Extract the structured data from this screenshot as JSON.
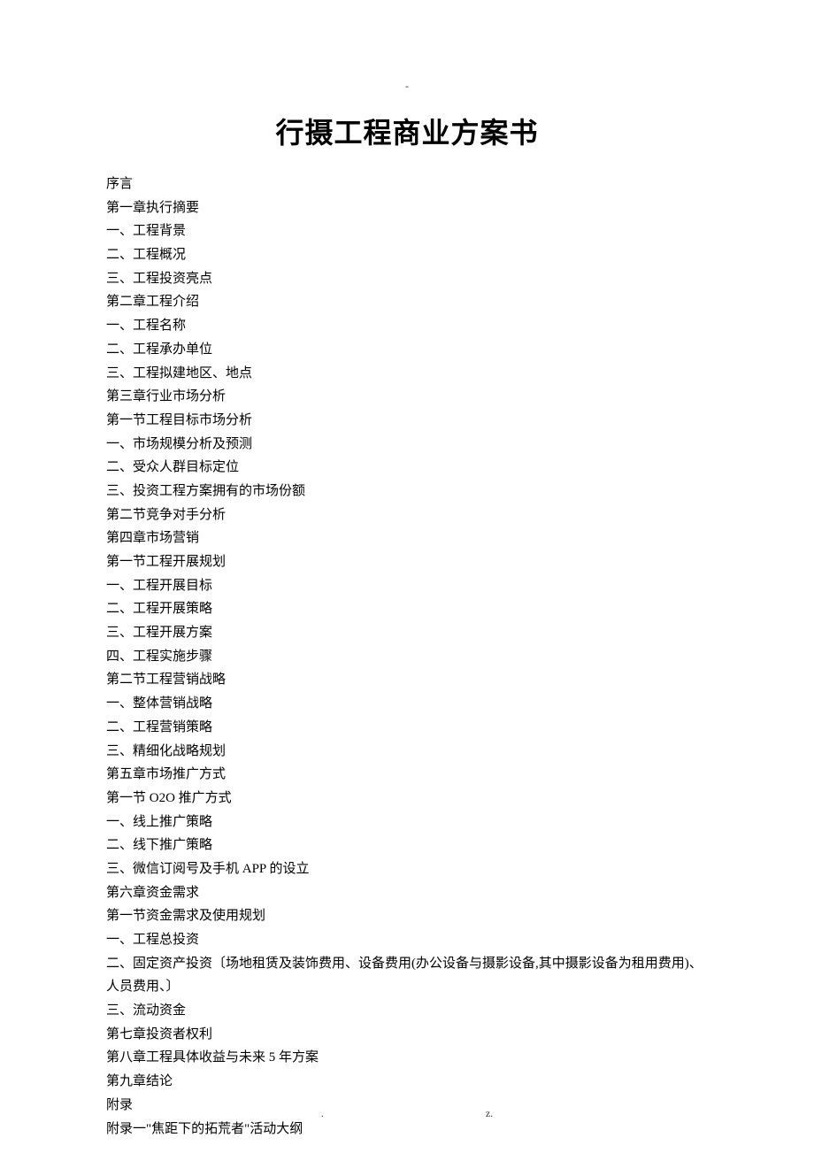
{
  "top_marker": "-",
  "title": "行摄工程商业方案书",
  "toc": [
    "序言",
    "第一章执行摘要",
    "一、工程背景",
    "二、工程概况",
    "三、工程投资亮点",
    "第二章工程介绍",
    "一、工程名称",
    "二、工程承办单位",
    "三、工程拟建地区、地点",
    "第三章行业市场分析",
    "第一节工程目标市场分析",
    "一、市场规模分析及预测",
    "二、受众人群目标定位",
    "三、投资工程方案拥有的市场份额",
    "第二节竞争对手分析",
    "第四章市场营销",
    "第一节工程开展规划",
    "一、工程开展目标",
    "二、工程开展策略",
    "三、工程开展方案",
    "四、工程实施步骤",
    "第二节工程营销战略",
    "一、整体营销战略",
    "二、工程营销策略",
    "三、精细化战略规划",
    "第五章市场推广方式",
    "第一节 O2O 推广方式",
    "一、线上推广策略",
    "二、线下推广策略",
    "三、微信订阅号及手机 APP 的设立",
    "第六章资金需求",
    "第一节资金需求及使用规划",
    "一、工程总投资",
    "二、固定资产投资〔场地租赁及装饰费用、设备费用(办公设备与摄影设备,其中摄影设备为租用费用)、人员费用、〕",
    "三、流动资金",
    "第七章投资者权利",
    "第八章工程具体收益与未来 5 年方案",
    "第九章结论",
    "附录",
    "附录一\"焦距下的拓荒者\"活动大纲"
  ],
  "footer": {
    "left": ".",
    "right": "z."
  }
}
